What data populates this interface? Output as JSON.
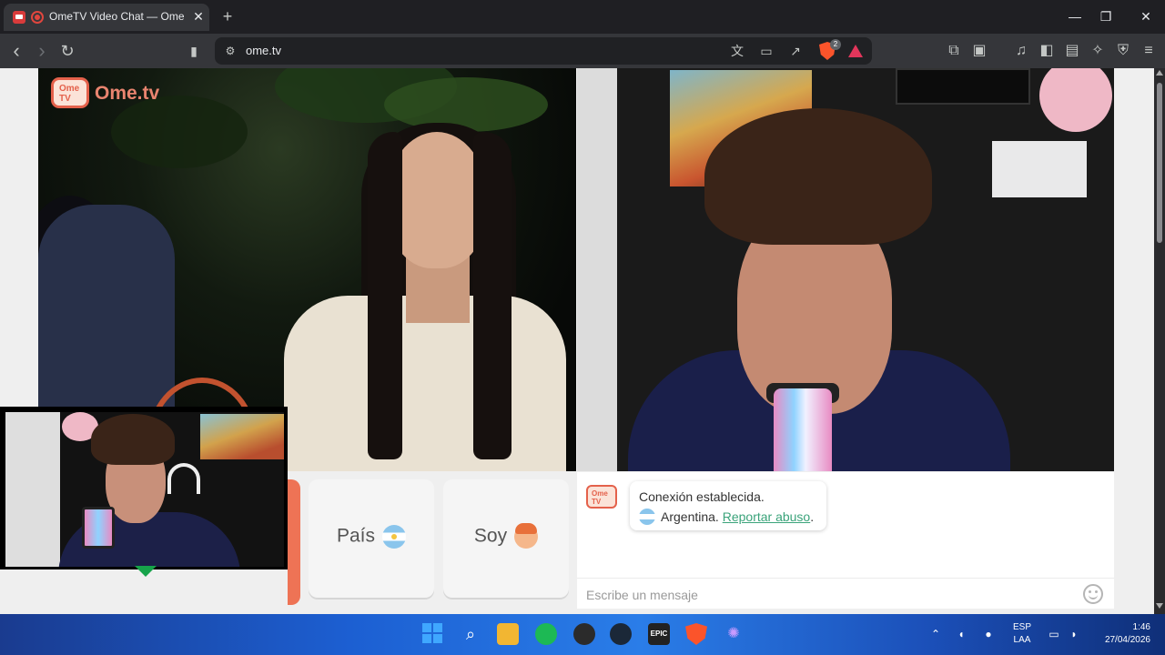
{
  "browser": {
    "tab_title": "OmeTV Video Chat — Omegle",
    "tab_close": "✕",
    "new_tab": "+",
    "window_controls": {
      "minimize": "—",
      "maximize": "❐",
      "close": "✕"
    },
    "nav": {
      "back": "‹",
      "forward": "›",
      "reload": "↻",
      "bookmark": "▮"
    },
    "url": "ome.tv",
    "shield_count": "2",
    "icons": [
      "translate-icon",
      "cast-icon",
      "share-icon",
      "brave-shields-icon",
      "brave-rewards-icon",
      "extensions-icon",
      "screenshot-icon",
      "media-icon",
      "sidebar-icon",
      "wallet-icon",
      "leo-icon",
      "vpn-icon",
      "menu-icon"
    ]
  },
  "site": {
    "logo_badge": "Ome TV",
    "logo_text": "Ome.tv",
    "brand_color": "#e4614b"
  },
  "controls": {
    "country_label": "País",
    "gender_label": "Soy"
  },
  "chat": {
    "message_line1": "Conexión establecida.",
    "country": "Argentina.",
    "report_link": "Reportar abuso",
    "report_suffix": ".",
    "input_placeholder": "Escribe un mensaje"
  },
  "taskbar": {
    "apps": [
      "start-icon",
      "search-icon",
      "file-explorer-icon",
      "spotify-icon",
      "obs-icon",
      "steam-icon",
      "epic-games-icon",
      "brave-icon",
      "app-icon"
    ],
    "epic_label": "EPIC",
    "language": "ESP",
    "keyboard_layout": "LAA",
    "time": "1:46",
    "date": "27/04/2026"
  }
}
